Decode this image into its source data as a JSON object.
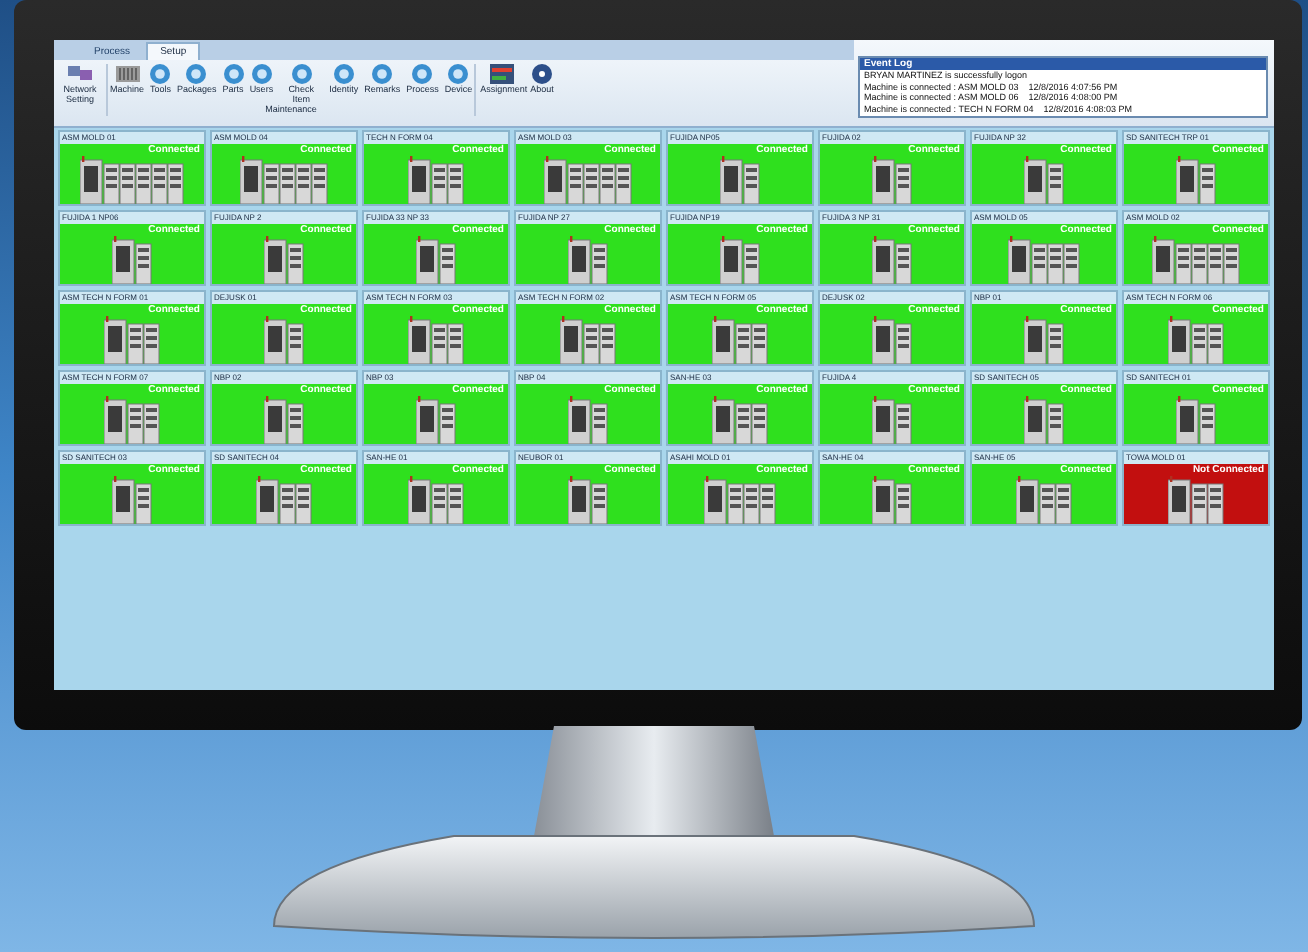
{
  "tabs": [
    {
      "label": "Process",
      "selected": false
    },
    {
      "label": "Setup",
      "selected": true
    }
  ],
  "ribbon": {
    "items": [
      {
        "label": "Network Setting",
        "kind": "network"
      },
      {
        "label": "Machine",
        "kind": "machine"
      },
      {
        "label": "Tools",
        "kind": "circle"
      },
      {
        "label": "Packages",
        "kind": "circle"
      },
      {
        "label": "Parts",
        "kind": "circle"
      },
      {
        "label": "Users",
        "kind": "circle"
      },
      {
        "label": "Check Item",
        "kind": "circle"
      },
      {
        "label": "Identity",
        "kind": "circle"
      },
      {
        "label": "Remarks",
        "kind": "circle"
      },
      {
        "label": "Process",
        "kind": "circle"
      },
      {
        "label": "Device",
        "kind": "circle"
      },
      {
        "label": "Assignment",
        "kind": "chart"
      },
      {
        "label": "About",
        "kind": "help"
      }
    ],
    "group_label": "Maintenance"
  },
  "event_log": {
    "title": "Event Log",
    "lines": [
      "BRYAN MARTINEZ is successfully logon",
      "Machine is connected : ASM MOLD 03    12/8/2016 4:07:56 PM",
      "Machine is connected : ASM MOLD 06    12/8/2016 4:08:00 PM",
      "Machine is connected : TECH N FORM 04    12/8/2016 4:08:03 PM"
    ]
  },
  "machines": [
    {
      "name": "ASM MOLD 01",
      "status": "Connected",
      "connected": true,
      "kind": "five"
    },
    {
      "name": "ASM MOLD 04",
      "status": "Connected",
      "connected": true,
      "kind": "four"
    },
    {
      "name": "TECH N FORM 04",
      "status": "Connected",
      "connected": true,
      "kind": "two"
    },
    {
      "name": "ASM MOLD 03",
      "status": "Connected",
      "connected": true,
      "kind": "four"
    },
    {
      "name": "FUJIDA NP05",
      "status": "Connected",
      "connected": true,
      "kind": "one"
    },
    {
      "name": "FUJIDA 02",
      "status": "Connected",
      "connected": true,
      "kind": "one"
    },
    {
      "name": "FUJIDA NP 32",
      "status": "Connected",
      "connected": true,
      "kind": "one"
    },
    {
      "name": "SD SANITECH TRP 01",
      "status": "Connected",
      "connected": true,
      "kind": "one"
    },
    {
      "name": "FUJIDA 1 NP06",
      "status": "Connected",
      "connected": true,
      "kind": "one"
    },
    {
      "name": "FUJIDA NP 2",
      "status": "Connected",
      "connected": true,
      "kind": "one"
    },
    {
      "name": "FUJIDA 33 NP 33",
      "status": "Connected",
      "connected": true,
      "kind": "one"
    },
    {
      "name": "FUJIDA NP 27",
      "status": "Connected",
      "connected": true,
      "kind": "one"
    },
    {
      "name": "FUJIDA NP19",
      "status": "Connected",
      "connected": true,
      "kind": "one"
    },
    {
      "name": "FUJIDA 3 NP 31",
      "status": "Connected",
      "connected": true,
      "kind": "one"
    },
    {
      "name": "ASM MOLD 05",
      "status": "Connected",
      "connected": true,
      "kind": "three"
    },
    {
      "name": "ASM MOLD 02",
      "status": "Connected",
      "connected": true,
      "kind": "four"
    },
    {
      "name": "ASM TECH N FORM 01",
      "status": "Connected",
      "connected": true,
      "kind": "two"
    },
    {
      "name": "DEJUSK 01",
      "status": "Connected",
      "connected": true,
      "kind": "one"
    },
    {
      "name": "ASM TECH N FORM 03",
      "status": "Connected",
      "connected": true,
      "kind": "two"
    },
    {
      "name": "ASM TECH N FORM 02",
      "status": "Connected",
      "connected": true,
      "kind": "two"
    },
    {
      "name": "ASM TECH N FORM 05",
      "status": "Connected",
      "connected": true,
      "kind": "two"
    },
    {
      "name": "DEJUSK 02",
      "status": "Connected",
      "connected": true,
      "kind": "one"
    },
    {
      "name": "NBP 01",
      "status": "Connected",
      "connected": true,
      "kind": "one"
    },
    {
      "name": "ASM TECH N FORM 06",
      "status": "Connected",
      "connected": true,
      "kind": "two"
    },
    {
      "name": "ASM TECH N FORM 07",
      "status": "Connected",
      "connected": true,
      "kind": "two"
    },
    {
      "name": "NBP 02",
      "status": "Connected",
      "connected": true,
      "kind": "one"
    },
    {
      "name": "NBP 03",
      "status": "Connected",
      "connected": true,
      "kind": "one"
    },
    {
      "name": "NBP 04",
      "status": "Connected",
      "connected": true,
      "kind": "one"
    },
    {
      "name": "SAN-HE 03",
      "status": "Connected",
      "connected": true,
      "kind": "two"
    },
    {
      "name": "FUJIDA 4",
      "status": "Connected",
      "connected": true,
      "kind": "one"
    },
    {
      "name": "SD SANITECH 05",
      "status": "Connected",
      "connected": true,
      "kind": "one"
    },
    {
      "name": "SD SANITECH 01",
      "status": "Connected",
      "connected": true,
      "kind": "one"
    },
    {
      "name": "SD SANITECH 03",
      "status": "Connected",
      "connected": true,
      "kind": "one"
    },
    {
      "name": "SD SANITECH 04",
      "status": "Connected",
      "connected": true,
      "kind": "two"
    },
    {
      "name": "SAN-HE 01",
      "status": "Connected",
      "connected": true,
      "kind": "two"
    },
    {
      "name": "NEUBOR 01",
      "status": "Connected",
      "connected": true,
      "kind": "one"
    },
    {
      "name": "ASAHI MOLD 01",
      "status": "Connected",
      "connected": true,
      "kind": "three"
    },
    {
      "name": "SAN-HE 04",
      "status": "Connected",
      "connected": true,
      "kind": "one"
    },
    {
      "name": "SAN-HE 05",
      "status": "Connected",
      "connected": true,
      "kind": "two"
    },
    {
      "name": "TOWA MOLD 01",
      "status": "Not Connected",
      "connected": false,
      "kind": "two"
    }
  ]
}
